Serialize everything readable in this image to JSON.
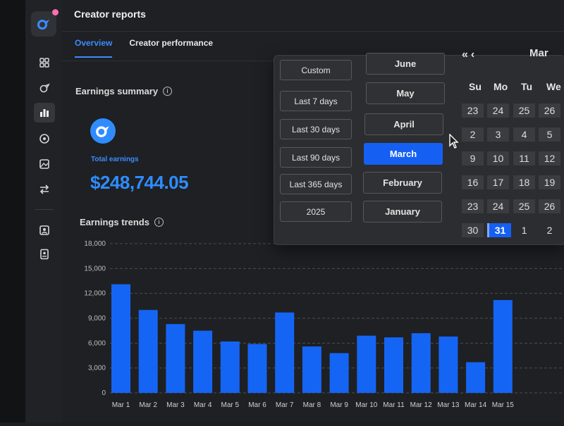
{
  "page": {
    "title": "Creator reports"
  },
  "tabs": [
    {
      "label": "Overview",
      "active": true
    },
    {
      "label": "Creator performance",
      "active": false
    }
  ],
  "sidebar": {
    "items": [
      {
        "icon": "grid-icon"
      },
      {
        "icon": "heart-tag-icon"
      },
      {
        "icon": "bar-chart-icon",
        "active": true
      },
      {
        "icon": "target-icon"
      },
      {
        "icon": "image-icon"
      },
      {
        "icon": "swap-arrows-icon"
      },
      {
        "icon": "profile-card-icon"
      },
      {
        "icon": "document-user-icon"
      }
    ]
  },
  "earnings_summary": {
    "title": "Earnings summary",
    "label": "Total earnings",
    "value": "$248,744.05"
  },
  "date_picker": {
    "ranges": [
      "Custom",
      "Last 7 days",
      "Last 30 days",
      "Last 90 days",
      "Last 365 days",
      "2025"
    ],
    "months": [
      "June",
      "May",
      "April",
      "March",
      "February",
      "January"
    ],
    "selected_month": "March",
    "calendar": {
      "nav": "«‹",
      "month_label": "Mar",
      "weekdays": [
        "Su",
        "Mo",
        "Tu",
        "We"
      ],
      "rows": [
        [
          "23",
          "24",
          "25",
          "26"
        ],
        [
          "2",
          "3",
          "4",
          "5"
        ],
        [
          "9",
          "10",
          "11",
          "12"
        ],
        [
          "16",
          "17",
          "18",
          "19"
        ],
        [
          "23",
          "24",
          "25",
          "26"
        ],
        [
          "30",
          "31",
          "1",
          "2"
        ]
      ],
      "selected_day": "31"
    }
  },
  "trends": {
    "title": "Earnings trends"
  },
  "colors": {
    "accent": "#1560f2",
    "bar": "#1565f5",
    "text_accent": "#3b8cff"
  },
  "chart_data": {
    "type": "bar",
    "title": "Earnings trends",
    "xlabel": "",
    "ylabel": "",
    "ylim": [
      0,
      18000
    ],
    "yticks": [
      "0",
      "3,000",
      "6,000",
      "9,000",
      "12,000",
      "15,000",
      "18,000"
    ],
    "categories": [
      "Mar 1",
      "Mar 2",
      "Mar 3",
      "Mar 4",
      "Mar 5",
      "Mar 6",
      "Mar 7",
      "Mar 8",
      "Mar 9",
      "Mar 10",
      "Mar 11",
      "Mar 12",
      "Mar 13",
      "Mar 14",
      "Mar 15"
    ],
    "values": [
      13100,
      10000,
      8300,
      7500,
      6200,
      5900,
      9700,
      5600,
      4800,
      6900,
      6700,
      7200,
      6800,
      3700,
      11200
    ],
    "grid": true
  }
}
